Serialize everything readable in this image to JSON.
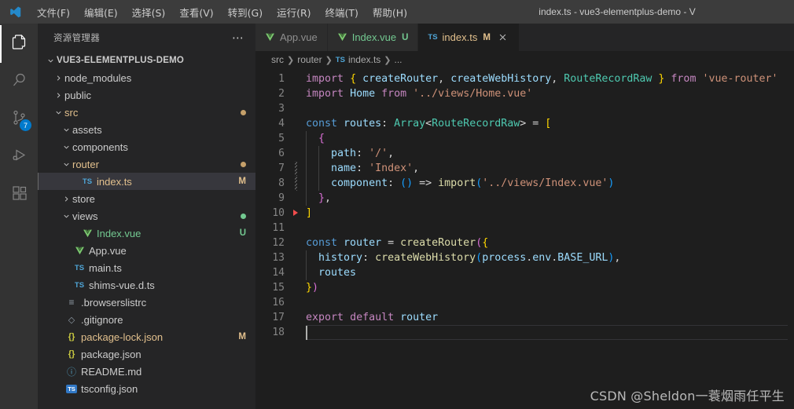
{
  "window": {
    "title": "index.ts - vue3-elementplus-demo - V",
    "logo_icon": "vscode-logo-icon"
  },
  "menu": {
    "items": [
      {
        "label": "文件(F)",
        "name": "menu-file"
      },
      {
        "label": "编辑(E)",
        "name": "menu-edit"
      },
      {
        "label": "选择(S)",
        "name": "menu-selection"
      },
      {
        "label": "查看(V)",
        "name": "menu-view"
      },
      {
        "label": "转到(G)",
        "name": "menu-go"
      },
      {
        "label": "运行(R)",
        "name": "menu-run"
      },
      {
        "label": "终端(T)",
        "name": "menu-terminal"
      },
      {
        "label": "帮助(H)",
        "name": "menu-help"
      }
    ]
  },
  "activitybar": {
    "items": [
      {
        "icon": "files-explorer-icon",
        "name": "activitybar-explorer",
        "active": true,
        "badge": ""
      },
      {
        "icon": "search-icon",
        "name": "activitybar-search",
        "active": false,
        "badge": ""
      },
      {
        "icon": "source-control-icon",
        "name": "activitybar-source-control",
        "active": false,
        "badge": "7"
      },
      {
        "icon": "run-debug-icon",
        "name": "activitybar-run-debug",
        "active": false,
        "badge": ""
      },
      {
        "icon": "extensions-icon",
        "name": "activitybar-extensions",
        "active": false,
        "badge": ""
      }
    ]
  },
  "sidebar": {
    "title": "资源管理器",
    "actions_icon": "more-actions-icon",
    "root": {
      "label": "VUE3-ELEMENTPLUS-DEMO",
      "expanded": true
    },
    "tree": [
      {
        "label": "node_modules",
        "depth": 1,
        "kind": "folder",
        "state": "collapsed",
        "badge": "",
        "dot": ""
      },
      {
        "label": "public",
        "depth": 1,
        "kind": "folder",
        "state": "collapsed",
        "badge": "",
        "dot": ""
      },
      {
        "label": "src",
        "depth": 1,
        "kind": "folder",
        "state": "expanded",
        "badge": "",
        "dot": "#c5a06a"
      },
      {
        "label": "assets",
        "depth": 2,
        "kind": "folder",
        "state": "expanded",
        "badge": "",
        "dot": ""
      },
      {
        "label": "components",
        "depth": 2,
        "kind": "folder",
        "state": "expanded",
        "badge": "",
        "dot": ""
      },
      {
        "label": "router",
        "depth": 2,
        "kind": "folder",
        "state": "expanded",
        "badge": "",
        "dot": "#c5a06a"
      },
      {
        "label": "index.ts",
        "depth": 3,
        "kind": "ts",
        "state": "file",
        "badge": "M",
        "dot": "",
        "selected": true
      },
      {
        "label": "store",
        "depth": 2,
        "kind": "folder",
        "state": "collapsed",
        "badge": "",
        "dot": ""
      },
      {
        "label": "views",
        "depth": 2,
        "kind": "folder",
        "state": "expanded",
        "badge": "",
        "dot": "#73c991"
      },
      {
        "label": "Index.vue",
        "depth": 3,
        "kind": "vue",
        "state": "file",
        "badge": "U",
        "dot": ""
      },
      {
        "label": "App.vue",
        "depth": 2,
        "kind": "vue",
        "state": "file",
        "badge": "",
        "dot": ""
      },
      {
        "label": "main.ts",
        "depth": 2,
        "kind": "ts",
        "state": "file",
        "badge": "",
        "dot": ""
      },
      {
        "label": "shims-vue.d.ts",
        "depth": 2,
        "kind": "ts",
        "state": "file",
        "badge": "",
        "dot": ""
      },
      {
        "label": ".browserslistrc",
        "depth": 1,
        "kind": "config",
        "state": "file",
        "badge": "",
        "dot": ""
      },
      {
        "label": ".gitignore",
        "depth": 1,
        "kind": "git",
        "state": "file",
        "badge": "",
        "dot": ""
      },
      {
        "label": "package-lock.json",
        "depth": 1,
        "kind": "json",
        "state": "file",
        "badge": "M",
        "dot": ""
      },
      {
        "label": "package.json",
        "depth": 1,
        "kind": "json",
        "state": "file",
        "badge": "",
        "dot": ""
      },
      {
        "label": "README.md",
        "depth": 1,
        "kind": "md",
        "state": "file",
        "badge": "",
        "dot": ""
      },
      {
        "label": "tsconfig.json",
        "depth": 1,
        "kind": "tsconf",
        "state": "file",
        "badge": "",
        "dot": ""
      }
    ]
  },
  "tabs": [
    {
      "label": "App.vue",
      "icon": "vue-file-icon",
      "dirty": "",
      "active": false,
      "closable": false
    },
    {
      "label": "Index.vue",
      "icon": "vue-file-icon",
      "dirty": "U",
      "active": false,
      "closable": false
    },
    {
      "label": "index.ts",
      "icon": "ts-file-icon",
      "dirty": "M",
      "active": true,
      "closable": true
    }
  ],
  "breadcrumbs": [
    {
      "label": "src",
      "icon": ""
    },
    {
      "label": "router",
      "icon": ""
    },
    {
      "label": "index.ts",
      "icon": "ts-file-icon"
    },
    {
      "label": "...",
      "icon": ""
    }
  ],
  "editor": {
    "line_numbers": [
      1,
      2,
      3,
      4,
      5,
      6,
      7,
      8,
      9,
      10,
      11,
      12,
      13,
      14,
      15,
      16,
      17,
      18
    ],
    "current_line": 18,
    "breakpoint_line": 10,
    "diff_lines": [
      7,
      8
    ],
    "code": [
      {
        "n": 1,
        "tokens": [
          [
            "t-kw",
            "import"
          ],
          [
            "t-punc",
            " "
          ],
          [
            "t-y",
            "{"
          ],
          [
            "t-punc",
            " "
          ],
          [
            "t-var",
            "createRouter"
          ],
          [
            "t-punc",
            ", "
          ],
          [
            "t-var",
            "createWebHistory"
          ],
          [
            "t-punc",
            ", "
          ],
          [
            "t-type",
            "RouteRecordRaw"
          ],
          [
            "t-punc",
            " "
          ],
          [
            "t-y",
            "}"
          ],
          [
            "t-punc",
            " "
          ],
          [
            "t-kw",
            "from"
          ],
          [
            "t-punc",
            " "
          ],
          [
            "t-str",
            "'vue-router'"
          ]
        ]
      },
      {
        "n": 2,
        "tokens": [
          [
            "t-kw",
            "import"
          ],
          [
            "t-punc",
            " "
          ],
          [
            "t-var",
            "Home"
          ],
          [
            "t-punc",
            " "
          ],
          [
            "t-kw",
            "from"
          ],
          [
            "t-punc",
            " "
          ],
          [
            "t-str",
            "'../views/Home.vue'"
          ]
        ]
      },
      {
        "n": 3,
        "tokens": []
      },
      {
        "n": 4,
        "tokens": [
          [
            "t-ctl",
            "const"
          ],
          [
            "t-punc",
            " "
          ],
          [
            "t-var",
            "routes"
          ],
          [
            "t-punc",
            ": "
          ],
          [
            "t-type",
            "Array"
          ],
          [
            "t-punc",
            "<"
          ],
          [
            "t-type",
            "RouteRecordRaw"
          ],
          [
            "t-punc",
            "> = "
          ],
          [
            "t-y",
            "["
          ]
        ]
      },
      {
        "n": 5,
        "tokens": [
          [
            "t-punc",
            "  "
          ],
          [
            "t-p",
            "{"
          ]
        ]
      },
      {
        "n": 6,
        "tokens": [
          [
            "t-punc",
            "    "
          ],
          [
            "t-var",
            "path"
          ],
          [
            "t-punc",
            ": "
          ],
          [
            "t-str",
            "'/'"
          ],
          [
            "t-punc",
            ","
          ]
        ]
      },
      {
        "n": 7,
        "tokens": [
          [
            "t-punc",
            "    "
          ],
          [
            "t-var",
            "name"
          ],
          [
            "t-punc",
            ": "
          ],
          [
            "t-str",
            "'Index'"
          ],
          [
            "t-punc",
            ","
          ]
        ]
      },
      {
        "n": 8,
        "tokens": [
          [
            "t-punc",
            "    "
          ],
          [
            "t-var",
            "component"
          ],
          [
            "t-punc",
            ": "
          ],
          [
            "t-b",
            "()"
          ],
          [
            "t-punc",
            " "
          ],
          [
            "t-op",
            "=>"
          ],
          [
            "t-punc",
            " "
          ],
          [
            "t-fn",
            "import"
          ],
          [
            "t-b",
            "("
          ],
          [
            "t-str",
            "'../views/Index.vue'"
          ],
          [
            "t-b",
            ")"
          ]
        ]
      },
      {
        "n": 9,
        "tokens": [
          [
            "t-punc",
            "  "
          ],
          [
            "t-p",
            "}"
          ],
          [
            "t-punc",
            ","
          ]
        ]
      },
      {
        "n": 10,
        "tokens": [
          [
            "t-y",
            "]"
          ]
        ]
      },
      {
        "n": 11,
        "tokens": []
      },
      {
        "n": 12,
        "tokens": [
          [
            "t-ctl",
            "const"
          ],
          [
            "t-punc",
            " "
          ],
          [
            "t-var",
            "router"
          ],
          [
            "t-punc",
            " = "
          ],
          [
            "t-fn",
            "createRouter"
          ],
          [
            "t-p",
            "("
          ],
          [
            "t-y",
            "{"
          ]
        ]
      },
      {
        "n": 13,
        "tokens": [
          [
            "t-punc",
            "  "
          ],
          [
            "t-var",
            "history"
          ],
          [
            "t-punc",
            ": "
          ],
          [
            "t-fn",
            "createWebHistory"
          ],
          [
            "t-b",
            "("
          ],
          [
            "t-var",
            "process"
          ],
          [
            "t-punc",
            "."
          ],
          [
            "t-var",
            "env"
          ],
          [
            "t-punc",
            "."
          ],
          [
            "t-var",
            "BASE_URL"
          ],
          [
            "t-b",
            ")"
          ],
          [
            "t-punc",
            ","
          ]
        ]
      },
      {
        "n": 14,
        "tokens": [
          [
            "t-punc",
            "  "
          ],
          [
            "t-var",
            "routes"
          ]
        ]
      },
      {
        "n": 15,
        "tokens": [
          [
            "t-y",
            "}"
          ],
          [
            "t-p",
            ")"
          ]
        ]
      },
      {
        "n": 16,
        "tokens": []
      },
      {
        "n": 17,
        "tokens": [
          [
            "t-kw",
            "export"
          ],
          [
            "t-punc",
            " "
          ],
          [
            "t-kw",
            "default"
          ],
          [
            "t-punc",
            " "
          ],
          [
            "t-var",
            "router"
          ]
        ]
      },
      {
        "n": 18,
        "tokens": []
      }
    ]
  },
  "watermark": {
    "text": "CSDN @Sheldon一蓑烟雨任平生"
  },
  "colors": {
    "accent": "#007acc",
    "modified": "#e2c08d",
    "untracked": "#73c991",
    "breakpoint": "#f14c4c",
    "editor_bg": "#1e1e1e",
    "sidebar_bg": "#252526",
    "titlebar_bg": "#3c3c3c",
    "activitybar_bg": "#333333"
  }
}
